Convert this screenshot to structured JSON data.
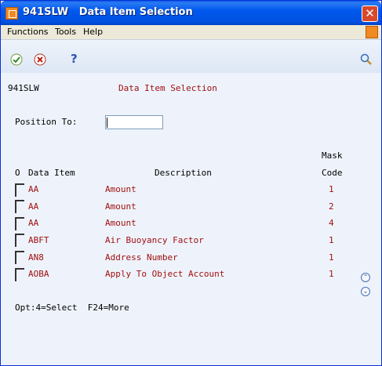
{
  "window": {
    "title": "941SLW   Data Item Selection",
    "close_glyph": "✕"
  },
  "menu": {
    "items": [
      {
        "label": "Functions"
      },
      {
        "label": "Tools"
      },
      {
        "label": "Help"
      }
    ]
  },
  "toolbar": {
    "icons": [
      "check-icon",
      "cancel-icon",
      "help-icon",
      "search-icon"
    ],
    "help_glyph": "?"
  },
  "form": {
    "program_id": "941SLW",
    "heading": "Data Item Selection",
    "position_label": "Position To:",
    "position_value": ""
  },
  "table": {
    "header_mask": "Mask",
    "col_o": "O",
    "col_data_item": "Data Item",
    "col_description": "Description",
    "col_code": "Code",
    "rows": [
      {
        "item": "AA",
        "description": "Amount",
        "code": "1"
      },
      {
        "item": "AA",
        "description": "Amount",
        "code": "2"
      },
      {
        "item": "AA",
        "description": "Amount",
        "code": "4"
      },
      {
        "item": "ABFT",
        "description": "Air Buoyancy Factor",
        "code": "1"
      },
      {
        "item": "AN8",
        "description": "Address Number",
        "code": "1"
      },
      {
        "item": "AOBA",
        "description": "Apply To Object Account",
        "code": "1"
      }
    ]
  },
  "footer": {
    "options": "Opt:4=Select  F24=More"
  },
  "scroll": {
    "up_glyph": "⌃",
    "down_glyph": "⌄"
  }
}
